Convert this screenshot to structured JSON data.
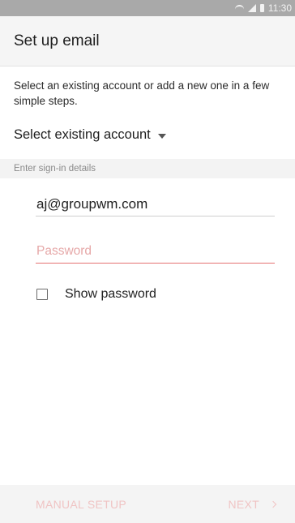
{
  "status_bar": {
    "time": "11:30",
    "icons": [
      "wifi-icon",
      "signal-icon",
      "battery-icon"
    ]
  },
  "header": {
    "title": "Set up email"
  },
  "intro": {
    "description": "Select an existing account or add a new one in a few simple steps."
  },
  "account_selector": {
    "label": "Select existing account",
    "icon": "dropdown-caret-icon"
  },
  "signin_section": {
    "header": "Enter sign-in details",
    "email_value": "aj@groupwm.com",
    "password_placeholder": "Password",
    "show_password_label": "Show password",
    "show_password_checked": false
  },
  "footer": {
    "manual_setup_label": "MANUAL SETUP",
    "next_label": "NEXT",
    "next_icon": "chevron-right-icon"
  },
  "colors": {
    "status_bar": "#a9a9a9",
    "accent_error": "#e57373",
    "disabled_action": "#f0c4c4"
  }
}
